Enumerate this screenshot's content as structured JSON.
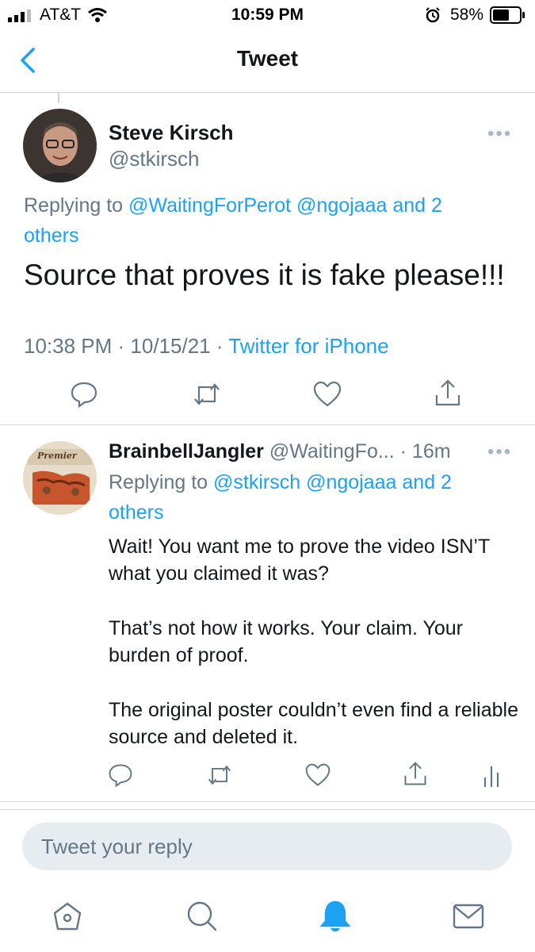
{
  "status_bar": {
    "carrier": "AT&T",
    "time": "10:59 PM",
    "battery": "58%"
  },
  "nav": {
    "title": "Tweet"
  },
  "tweet": {
    "author_name": "Steve Kirsch",
    "author_handle": "@stkirsch",
    "replying_prefix": "Replying to ",
    "replying_to": "@WaitingForPerot @ngojaaa and 2 others",
    "text": "Source that proves it is fake please!!!",
    "time": "10:38 PM",
    "date": "10/15/21",
    "separator": " · ",
    "source": "Twitter for iPhone",
    "more": "•••"
  },
  "reply": {
    "author_name": "BrainbellJangler",
    "author_handle": "@WaitingFo...",
    "age": "· 16m",
    "replying_prefix": "Replying to ",
    "replying_to": "@stkirsch @ngojaaa and 2 others",
    "avatar_text": "Premier",
    "paragraphs": [
      "Wait! You want me to prove the video ISN’T what you claimed it was?",
      "That’s not how it works. Your claim. Your burden of proof.",
      "The original poster couldn’t even find a reliable source and deleted it."
    ],
    "more": "•••"
  },
  "compose": {
    "placeholder": "Tweet your reply"
  },
  "icons": {
    "reply": "comment-icon",
    "retweet": "retweet-icon",
    "like": "heart-icon",
    "share": "share-icon",
    "analytics": "analytics-icon",
    "home": "home-icon",
    "search": "search-icon",
    "notifications": "bell-icon",
    "messages": "mail-icon"
  },
  "colors": {
    "accent": "#1da1f2",
    "secondary_text": "#657786",
    "divider": "#d4d8db"
  }
}
